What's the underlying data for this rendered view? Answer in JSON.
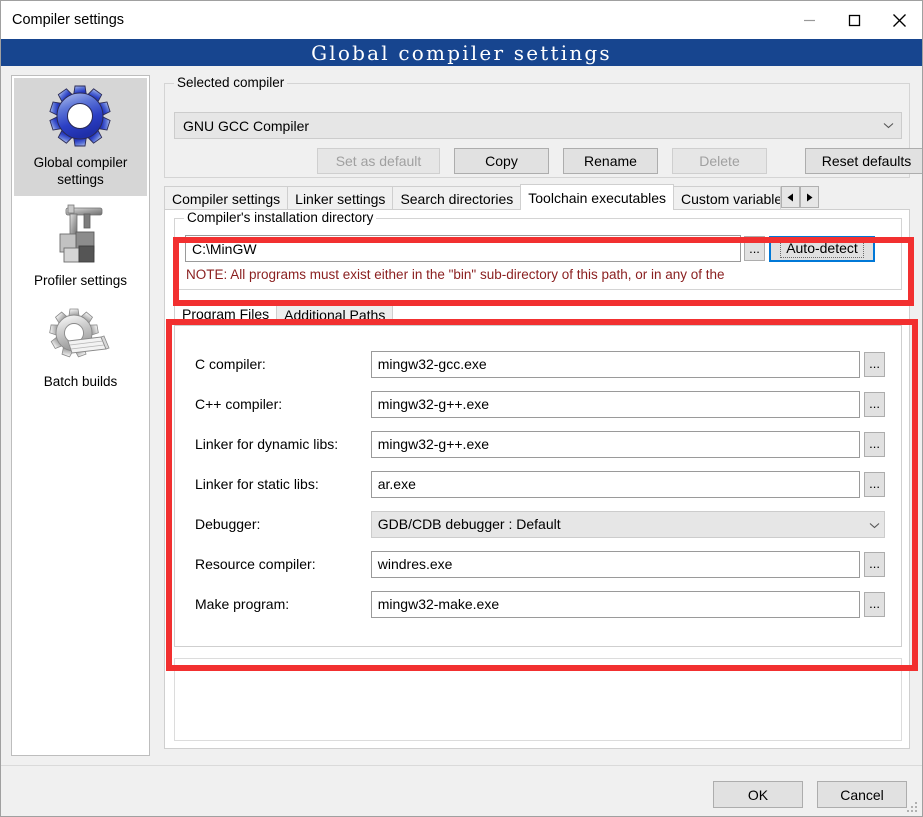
{
  "window": {
    "title": "Compiler settings",
    "banner_title": "Global compiler settings",
    "controls": {
      "minimize": "minimize-icon",
      "maximize": "maximize-icon",
      "close": "close-icon"
    }
  },
  "sidebar": {
    "items": [
      {
        "label": "Global compiler settings",
        "icon": "blue-gear-icon",
        "selected": true
      },
      {
        "label": "Profiler settings",
        "icon": "caliper-blocks-icon",
        "selected": false
      },
      {
        "label": "Batch builds",
        "icon": "gear-pages-icon",
        "selected": false
      }
    ]
  },
  "selected_compiler": {
    "group_title": "Selected compiler",
    "combo_value": "GNU GCC Compiler",
    "buttons": {
      "set_as_default": "Set as default",
      "copy": "Copy",
      "rename": "Rename",
      "delete": "Delete",
      "reset_defaults": "Reset defaults"
    }
  },
  "tabs": {
    "items": [
      {
        "label": "Compiler settings",
        "active": false
      },
      {
        "label": "Linker settings",
        "active": false
      },
      {
        "label": "Search directories",
        "active": false
      },
      {
        "label": "Toolchain executables",
        "active": true
      },
      {
        "label": "Custom variable",
        "active": false
      }
    ],
    "scroll_left": "◀",
    "scroll_right": "▶"
  },
  "install_dir": {
    "group_title": "Compiler's installation directory",
    "value": "C:\\MinGW",
    "browse_label": "...",
    "auto_detect_label": "Auto-detect",
    "note": "NOTE: All programs must exist either in the \"bin\" sub-directory of this path, or in any of the"
  },
  "inner_tabs": {
    "items": [
      {
        "label": "Program Files",
        "active": true
      },
      {
        "label": "Additional Paths",
        "active": false
      }
    ]
  },
  "program_files": {
    "browse_label": "...",
    "fields": [
      {
        "label": "C compiler:",
        "value": "mingw32-gcc.exe",
        "type": "text"
      },
      {
        "label": "C++ compiler:",
        "value": "mingw32-g++.exe",
        "type": "text"
      },
      {
        "label": "Linker for dynamic libs:",
        "value": "mingw32-g++.exe",
        "type": "text"
      },
      {
        "label": "Linker for static libs:",
        "value": "ar.exe",
        "type": "text"
      },
      {
        "label": "Debugger:",
        "value": "GDB/CDB debugger : Default",
        "type": "combo"
      },
      {
        "label": "Resource compiler:",
        "value": "windres.exe",
        "type": "text"
      },
      {
        "label": "Make program:",
        "value": "mingw32-make.exe",
        "type": "text"
      }
    ]
  },
  "footer": {
    "ok": "OK",
    "cancel": "Cancel"
  },
  "colors": {
    "banner_blue": "#17458f",
    "annotation_red": "#f23030",
    "note_red": "#8a1f1f",
    "focus_blue": "#0078d7",
    "selection_gray": "#d6d6d6"
  }
}
